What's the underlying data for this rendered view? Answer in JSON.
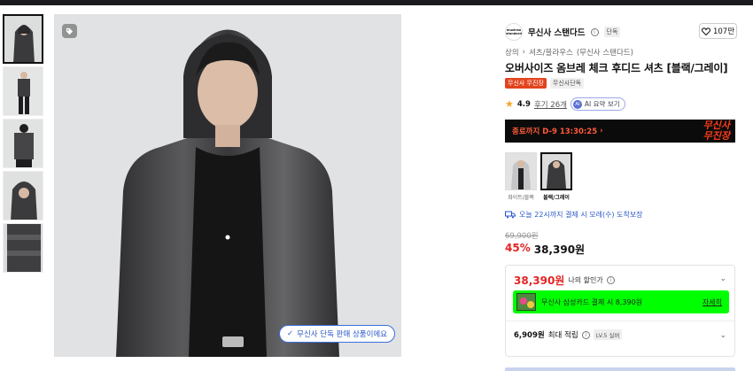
{
  "colors": {
    "accent_red": "#e52424",
    "brand_orange": "#e3431d",
    "link_blue": "#2a58c7",
    "card_banner_green": "#00ff00",
    "countdown_bg": "#0b0b0b"
  },
  "gallery": {
    "thumbnails": [
      "model-front-hood",
      "model-full-body",
      "model-back",
      "model-hood-closeup",
      "shirt-detail"
    ],
    "active_index": 0,
    "exclusive_label": "무신사 단독 판매 상품이에요"
  },
  "brand": {
    "logo_text": "musinsa standard",
    "name": "무신사 스탠다드",
    "badge": "단독",
    "likes": "107만"
  },
  "breadcrumb": [
    "상의",
    "셔츠/블라우스",
    "(무신사 스탠다드)"
  ],
  "product": {
    "title": "오버사이즈 옴브레 체크 후디드 셔츠 [블랙/그레이]",
    "badge_sale": "무신사 무진장",
    "badge_exclusive": "무신사단독"
  },
  "rating": {
    "score": "4.9",
    "reviews": "후기 26개",
    "ai_label": "AI 요약 보기"
  },
  "countdown": {
    "text": "종료까지 D-9 13:30:25",
    "logo_line1": "무신사",
    "logo_line2": "무진장"
  },
  "options": [
    {
      "label": "화이트/블랙",
      "selected": false
    },
    {
      "label": "블랙/그레이",
      "selected": true
    }
  ],
  "delivery": "오늘 22시까지 결제 시 모레(수) 도착보장",
  "price": {
    "original": "69,900원",
    "discount": "45%",
    "sale": "38,390원"
  },
  "benefits": {
    "my_price": "38,390원",
    "my_price_label": "나의 할인가",
    "card_text": "무신사 삼성카드 결제 시 8,390원",
    "card_link": "자세히",
    "points_value": "6,909원",
    "points_label": "최대 적립",
    "level": "LV.5 실버"
  }
}
